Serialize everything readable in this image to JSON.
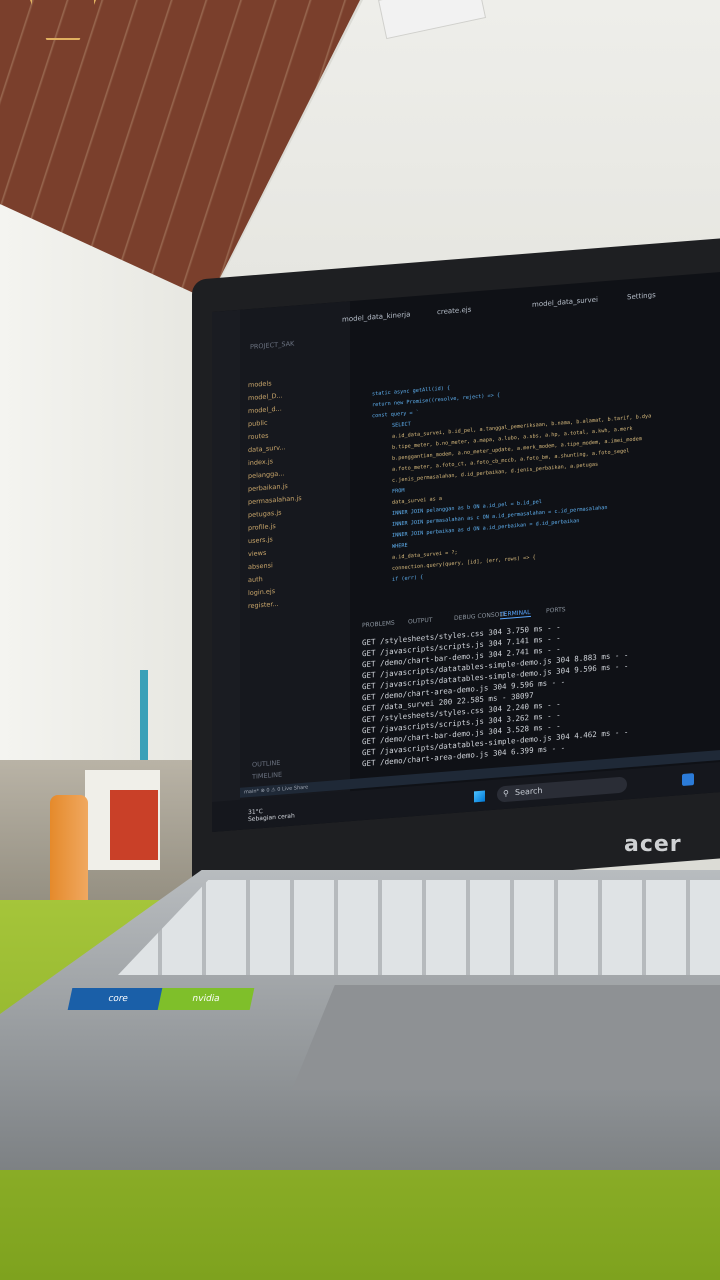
{
  "laptop": {
    "brand": "acer",
    "sticker_core": "core",
    "sticker_gpu": "nvidia"
  },
  "editor": {
    "tabs": [
      "model_data_kinerja",
      "create.ejs",
      "model_data_survei",
      "Settings"
    ],
    "explorer": {
      "project": "PROJECT_SAK",
      "items": [
        "models",
        "model_D...",
        "model_d...",
        "public",
        "routes",
        "data_surv...",
        "index.js",
        "pelangga...",
        "perbaikan.js",
        "permasalahan.js",
        "petugas.js",
        "profile.js",
        "users.js",
        "views",
        "absensi",
        "auth",
        "login.ejs",
        "register..."
      ],
      "sections": [
        "OUTLINE",
        "TIMELINE"
      ]
    },
    "code_lines": [
      "static async getAll(id) {",
      "return new Promise((resolve, reject) => {",
      "const query = `",
      "SELECT",
      "a.id_data_survei, b.id_pel, a.tanggal_pemeriksaan, b.nama, b.alamat, b.tarif, b.dya",
      "b.tipe_meter, b.no_meter, a.mapa, a.lubo, a.sbs, a.hp, a.total, a.kwh, a.merk",
      "b.penggantian_modem, a.no_meter_update, a.merk_modem, a.tipe_modem, a.imei_modem",
      "a.foto_meter, a.foto_ct, a.foto_cb_mccb, a.foto_bm, a.shunting, a.foto_segel",
      "c.jenis_permasalahan, d.id_perbaikan, d.jenis_perbaikan, a.petugas",
      "FROM",
      "data_survei as a",
      "INNER JOIN pelanggan as b ON a.id_pel = b.id_pel",
      "INNER JOIN permasalahan as c ON a.id_permasalahan = c.id_permasalahan",
      "INNER JOIN perbaikan as d ON a.id_perbaikan = d.id_perbaikan",
      "WHERE",
      "a.id_data_survei = ?;",
      "connection.query(query, [id], (err, rows) => {",
      "if (err) {"
    ],
    "panel_tabs": [
      "PROBLEMS",
      "OUTPUT",
      "DEBUG CONSOLE",
      "TERMINAL",
      "PORTS"
    ],
    "active_panel_tab": "TERMINAL",
    "terminal_lines": [
      "GET /stylesheets/styles.css 304 3.750 ms - -",
      "GET /javascripts/scripts.js 304 7.141 ms - -",
      "GET /demo/chart-bar-demo.js 304 2.741 ms - -",
      "GET /javascripts/datatables-simple-demo.js 304 8.883 ms - -",
      "GET /javascripts/datatables-simple-demo.js 304 9.596 ms - -",
      "GET /demo/chart-area-demo.js 304 9.596 ms - -",
      "GET /data_survei 200 22.585 ms - 38097",
      "GET /stylesheets/styles.css 304 2.240 ms - -",
      "GET /javascripts/scripts.js 304 3.262 ms - -",
      "GET /demo/chart-bar-demo.js 304 3.528 ms - -",
      "GET /javascripts/datatables-simple-demo.js 304 4.462 ms - -",
      "GET /demo/chart-area-demo.js 304 6.399 ms - -"
    ],
    "status_bar": "main*  ⊗ 0 ⚠ 0   Live Share"
  },
  "taskbar": {
    "weather_temp": "31°C",
    "weather_desc": "Sebagian cerah",
    "search_placeholder": "Search"
  }
}
